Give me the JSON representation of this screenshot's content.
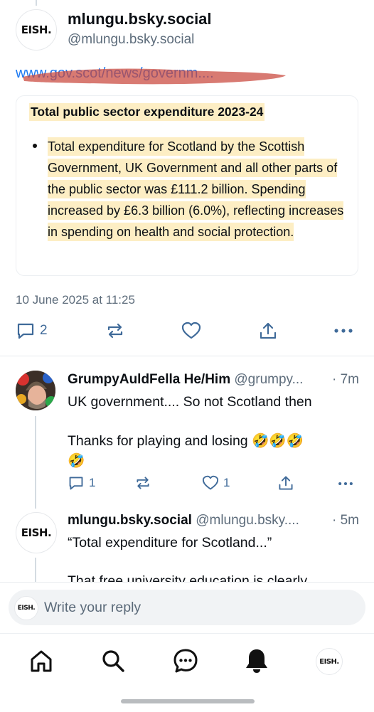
{
  "post": {
    "avatar_text": "EISH.",
    "display_name": "mlungu.bsky.social",
    "handle": "@mlungu.bsky.social",
    "link_text": "www.gov.scot/news/governm....",
    "card_title": "Total public sector expenditure 2023-24",
    "card_bullet": "Total expenditure for Scotland by the Scottish Government, UK Government and all other parts of the public sector was £111.2 billion. Spending increased by £6.3 billion (6.0%), reflecting increases in spending on health and social protection.",
    "timestamp": "10 June 2025 at 11:25",
    "reply_count": "2"
  },
  "replies": [
    {
      "display_name": "GrumpyAuldFella He/Him",
      "handle": "@grumpy...",
      "time": "· 7m",
      "line1": "UK government.... So not Scotland then",
      "line2": "Thanks for playing and losing 🤣🤣🤣",
      "line3": "🤣",
      "reply_count": "1",
      "like_count": "1"
    },
    {
      "avatar_text": "EISH.",
      "display_name": "mlungu.bsky.social",
      "handle": "@mlungu.bsky....",
      "time": "· 5m",
      "line1": "“Total expenditure for Scotland...”",
      "line2": "That free university education is clearly"
    }
  ],
  "composer": {
    "avatar_text": "EISH.",
    "placeholder": "Write your reply"
  },
  "nav": {
    "profile_text": "EISH."
  },
  "colors": {
    "highlight": "#fdeec4",
    "link": "#1d7af2",
    "scribble": "#c9463b"
  }
}
